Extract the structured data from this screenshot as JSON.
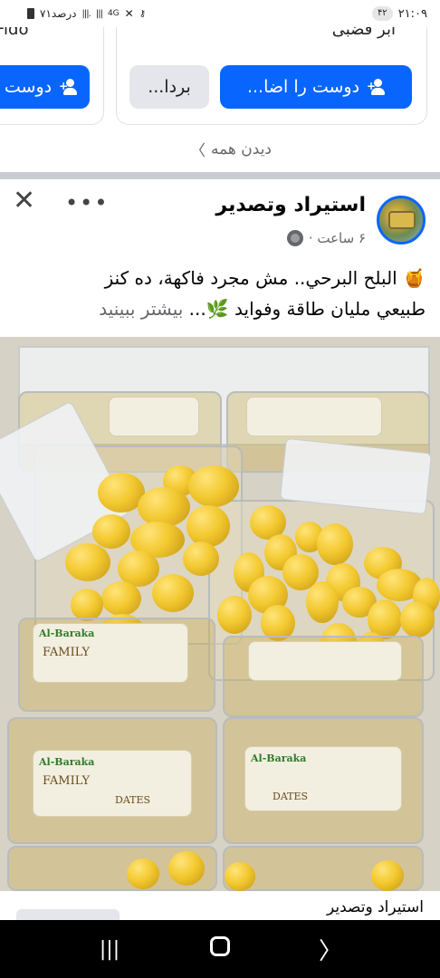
{
  "status_bar": {
    "time": "۲۱:۰۹",
    "notifications": "۴۲",
    "battery": "۷۱درصد"
  },
  "suggestions": {
    "card_left": {
      "name": "Fido",
      "add_label": "دوست"
    },
    "card_right": {
      "name": "آبر قضبی",
      "add_label": "دوست را اضا...",
      "remove_label": "بردا..."
    },
    "see_all": "دیدن همه"
  },
  "post": {
    "author": "استيراد وتصدير",
    "time": "۶ ساعت ·",
    "caption_line1": "🍯 البلح البرحي.. مش مجرد فاكهة، ده كنز",
    "caption_line2": "طبيعي مليان طاقة وفوايد 🌿...",
    "see_more": "بیشتر ببینید",
    "photo_labels": {
      "brand": "Al-Baraka",
      "variety": "FAMILY",
      "sub": "DATES"
    }
  },
  "next_post": {
    "author": "استيراد وتصدير"
  },
  "icons": {
    "recent_apps": "recent-apps-icon",
    "home": "home-icon",
    "back": "back-icon"
  }
}
